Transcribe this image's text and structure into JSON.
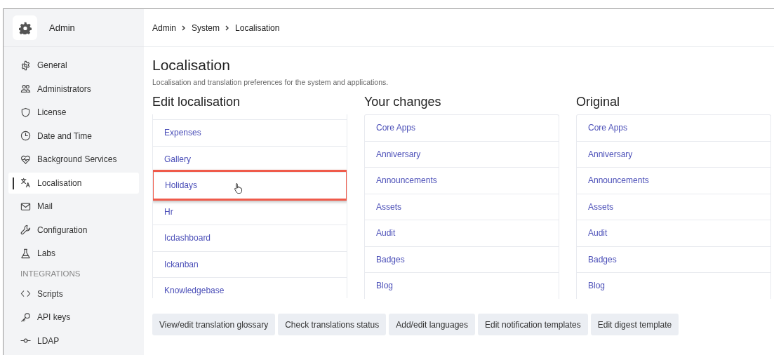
{
  "sidebar": {
    "title": "Admin",
    "items": [
      {
        "kind": "link",
        "label": "General",
        "selected": false
      },
      {
        "kind": "link",
        "label": "Administrators",
        "selected": false
      },
      {
        "kind": "link",
        "label": "License",
        "selected": false
      },
      {
        "kind": "link",
        "label": "Date and Time",
        "selected": false
      },
      {
        "kind": "link",
        "label": "Background Services",
        "selected": false
      },
      {
        "kind": "link",
        "label": "Localisation",
        "selected": true
      },
      {
        "kind": "link",
        "label": "Mail",
        "selected": false
      },
      {
        "kind": "link",
        "label": "Configuration",
        "selected": false
      },
      {
        "kind": "link",
        "label": "Labs",
        "selected": false
      },
      {
        "kind": "section",
        "label": "INTEGRATIONS"
      },
      {
        "kind": "link",
        "label": "Scripts",
        "selected": false
      },
      {
        "kind": "link",
        "label": "API keys",
        "selected": false
      },
      {
        "kind": "link",
        "label": "LDAP",
        "selected": false
      }
    ]
  },
  "breadcrumb": [
    "Admin",
    "System",
    "Localisation"
  ],
  "page": {
    "title": "Localisation",
    "subtitle": "Localisation and translation preferences for the system and applications."
  },
  "columns": [
    {
      "heading": "Edit localisation",
      "scrolled": true,
      "items": [
        {
          "label": "Expenses",
          "highlighted": false
        },
        {
          "label": "Gallery",
          "highlighted": false
        },
        {
          "label": "Holidays",
          "highlighted": true
        },
        {
          "label": "Hr",
          "highlighted": false
        },
        {
          "label": "Icdashboard",
          "highlighted": false
        },
        {
          "label": "Ickanban",
          "highlighted": false
        },
        {
          "label": "Knowledgebase",
          "highlighted": false
        }
      ]
    },
    {
      "heading": "Your changes",
      "scrolled": false,
      "items": [
        {
          "label": "Core Apps",
          "highlighted": false
        },
        {
          "label": "Anniversary",
          "highlighted": false
        },
        {
          "label": "Announcements",
          "highlighted": false
        },
        {
          "label": "Assets",
          "highlighted": false
        },
        {
          "label": "Audit",
          "highlighted": false
        },
        {
          "label": "Badges",
          "highlighted": false
        },
        {
          "label": "Blog",
          "highlighted": false
        }
      ]
    },
    {
      "heading": "Original",
      "scrolled": false,
      "items": [
        {
          "label": "Core Apps",
          "highlighted": false
        },
        {
          "label": "Anniversary",
          "highlighted": false
        },
        {
          "label": "Announcements",
          "highlighted": false
        },
        {
          "label": "Assets",
          "highlighted": false
        },
        {
          "label": "Audit",
          "highlighted": false
        },
        {
          "label": "Badges",
          "highlighted": false
        },
        {
          "label": "Blog",
          "highlighted": false
        }
      ]
    }
  ],
  "buttons": [
    "View/edit translation glossary",
    "Check translations status",
    "Add/edit languages",
    "Edit notification templates",
    "Edit digest template"
  ]
}
